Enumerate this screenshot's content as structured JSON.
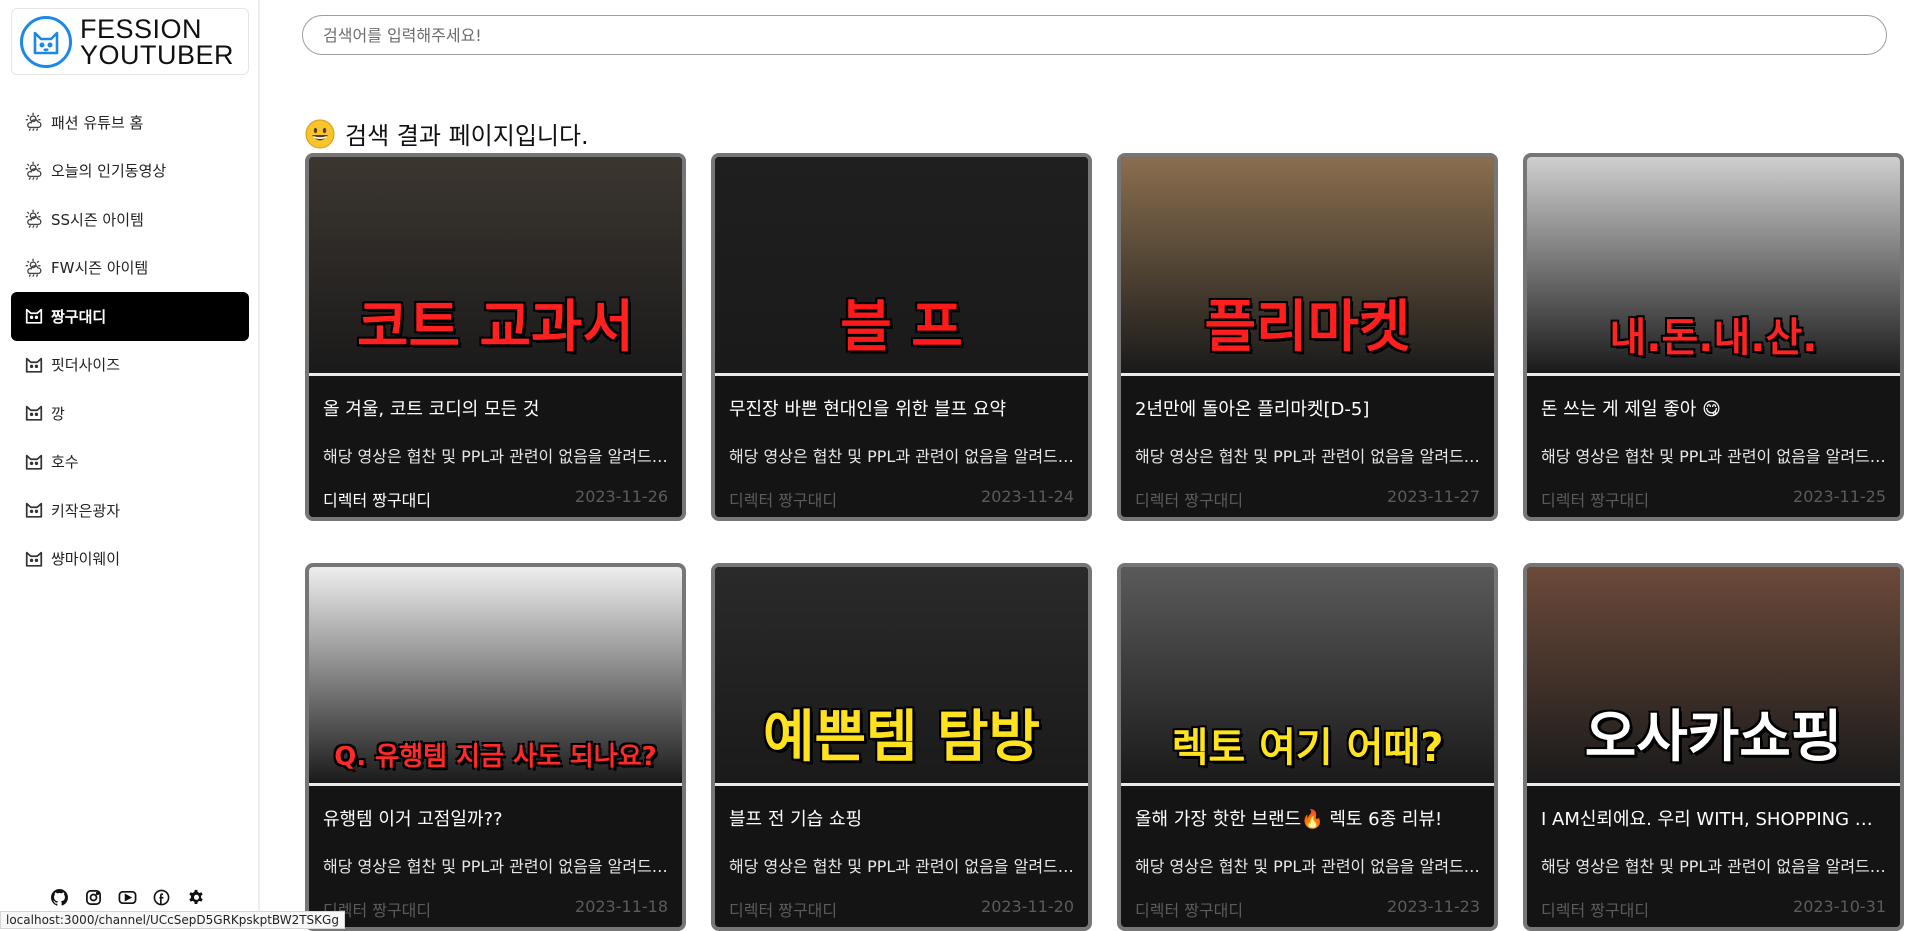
{
  "logo": {
    "line1": "FESSION",
    "line2": "YOUTUBER"
  },
  "sidebar": {
    "items": [
      {
        "label": "패션 유튜브 홈",
        "icon": "sun-cloud-icon"
      },
      {
        "label": "오늘의 인기동영상",
        "icon": "sun-cloud-icon"
      },
      {
        "label": "SS시즌 아이템",
        "icon": "sun-cloud-icon"
      },
      {
        "label": "FW시즌 아이템",
        "icon": "sun-cloud-icon"
      },
      {
        "label": "짱구대디",
        "icon": "cat-icon",
        "active": true
      },
      {
        "label": "핏더사이즈",
        "icon": "cat-icon"
      },
      {
        "label": "깡",
        "icon": "cat-icon"
      },
      {
        "label": "호수",
        "icon": "cat-icon"
      },
      {
        "label": "키작은광자",
        "icon": "cat-icon"
      },
      {
        "label": "썅마이웨이",
        "icon": "cat-icon"
      }
    ],
    "footer_icons": [
      "github-icon",
      "instagram-icon",
      "youtube-icon",
      "facebook-icon",
      "settings-icon"
    ]
  },
  "search": {
    "placeholder": "검색어를 입력해주세요!",
    "value": ""
  },
  "heading": {
    "text": "검색 결과 페이지입니다."
  },
  "status_url": "localhost:3000/channel/UCcSepD5GRKpskptBW2TSKGg",
  "cards": [
    {
      "title": "올 겨울, 코트 코디의 모든 것",
      "desc": "해당 영상은 협찬 및 PPL과 관련이 없음을 알려드립니다.",
      "channel": "디렉터 짱구대디",
      "date": "2023-11-26",
      "overlay": "코트 교과서",
      "overlay_color": "#ff2020",
      "bg": "#3c3630"
    },
    {
      "title": "무진장 바쁜 현대인을 위한 블프 요약",
      "desc": "해당 영상은 협찬 및 PPL과 관련이 없음을 알려드립니다.",
      "channel": "디렉터 짱구대디",
      "date": "2023-11-24",
      "overlay": "블   프",
      "overlay_color": "#ff1a1a",
      "bg": "#1f1f1f"
    },
    {
      "title": "2년만에 돌아온 플리마켓[D-5]",
      "desc": "해당 영상은 협찬 및 PPL과 관련이 없음을 알려드립니다.",
      "channel": "디렉터 짱구대디",
      "date": "2023-11-27",
      "overlay": "플리마켓",
      "overlay_color": "#ff1f1f",
      "bg": "#8a6f4f"
    },
    {
      "title": "돈 쓰는 게 제일 좋아 😋",
      "desc": "해당 영상은 협찬 및 PPL과 관련이 없음을 알려드립니다.",
      "channel": "디렉터 짱구대디",
      "date": "2023-11-25",
      "overlay": "내.돈.내.산.",
      "overlay_color": "#ff2424",
      "bg": "#cfcfcf"
    },
    {
      "title": "유행템 이거 고점일까??",
      "desc": "해당 영상은 협찬 및 PPL과 관련이 없음을 알려드립니다.",
      "channel": "디렉터 짱구대디",
      "date": "2023-11-18",
      "overlay": "Q. 유행템 지금 사도 되나요?",
      "overlay_color": "#ff2a2a",
      "bg": "#eeeeee"
    },
    {
      "title": "블프 전 기습 쇼핑",
      "desc": "해당 영상은 협찬 및 PPL과 관련이 없음을 알려드립니다.",
      "channel": "디렉터 짱구대디",
      "date": "2023-11-20",
      "overlay": "예쁜템 탐방",
      "overlay_color": "#ffe21f",
      "bg": "#2a2a2a"
    },
    {
      "title": "올해 가장 핫한 브랜드🔥 렉토 6종 리뷰!",
      "desc": "해당 영상은 협찬 및 PPL과 관련이 없음을 알려드립니다.",
      "channel": "디렉터 짱구대디",
      "date": "2023-11-23",
      "overlay": "렉토 여기 어때?",
      "overlay_color": "#ffe31f",
      "bg": "#5a5a5a"
    },
    {
      "title": "I AM신뢰에요. 우리 WITH, SHOPPING 어때요?",
      "desc": "해당 영상은 협찬 및 PPL과 관련이 없음을 알려드립니다.",
      "channel": "디렉터 짱구대디",
      "date": "2023-10-31",
      "overlay": "오사카쇼핑",
      "overlay_color": "#ffffff",
      "bg": "#6b4a3a"
    }
  ]
}
